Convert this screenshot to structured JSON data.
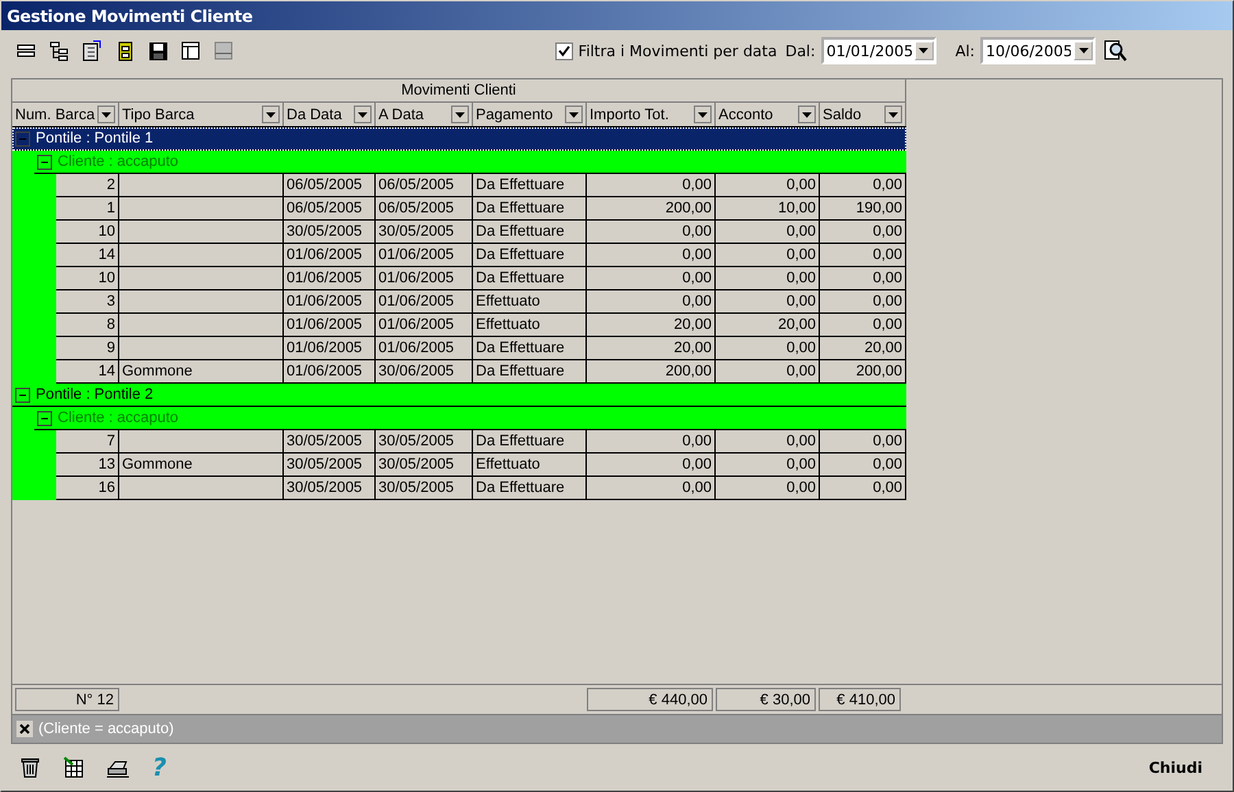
{
  "window": {
    "title": "Gestione Movimenti Cliente"
  },
  "filter": {
    "label": "Filtra i Movimenti per data",
    "checked": true,
    "from_label": "Dal:",
    "from_value": "01/01/2005",
    "to_label": "Al:",
    "to_value": "10/06/2005"
  },
  "grid": {
    "band": "Movimenti Clienti",
    "columns": [
      "Num. Barca",
      "Tipo Barca",
      "Da Data",
      "A Data",
      "Pagamento",
      "Importo Tot.",
      "Acconto",
      "Saldo"
    ],
    "groups": [
      {
        "label": "Pontile : Pontile 1",
        "selected": true,
        "expanded": true,
        "children": [
          {
            "label": "Cliente : accaputo",
            "expanded": true,
            "rows": [
              {
                "num_barca": "2",
                "da_data": "06/05/2005",
                "a_data": "06/05/2005",
                "pagamento": "Da Effettuare",
                "importo_tot": "0,00",
                "acconto": "0,00",
                "saldo": "0,00"
              },
              {
                "num_barca": "1",
                "da_data": "06/05/2005",
                "a_data": "06/05/2005",
                "pagamento": "Da Effettuare",
                "importo_tot": "200,00",
                "acconto": "10,00",
                "saldo": "190,00"
              },
              {
                "num_barca": "10",
                "da_data": "30/05/2005",
                "a_data": "30/05/2005",
                "pagamento": "Da Effettuare",
                "importo_tot": "0,00",
                "acconto": "0,00",
                "saldo": "0,00"
              },
              {
                "num_barca": "14",
                "da_data": "01/06/2005",
                "a_data": "01/06/2005",
                "pagamento": "Da Effettuare",
                "importo_tot": "0,00",
                "acconto": "0,00",
                "saldo": "0,00"
              },
              {
                "num_barca": "10",
                "da_data": "01/06/2005",
                "a_data": "01/06/2005",
                "pagamento": "Da Effettuare",
                "importo_tot": "0,00",
                "acconto": "0,00",
                "saldo": "0,00"
              },
              {
                "num_barca": "3",
                "da_data": "01/06/2005",
                "a_data": "01/06/2005",
                "pagamento": "Effettuato",
                "importo_tot": "0,00",
                "acconto": "0,00",
                "saldo": "0,00"
              },
              {
                "num_barca": "8",
                "da_data": "01/06/2005",
                "a_data": "01/06/2005",
                "pagamento": "Effettuato",
                "importo_tot": "20,00",
                "acconto": "20,00",
                "saldo": "0,00"
              },
              {
                "num_barca": "9",
                "da_data": "01/06/2005",
                "a_data": "01/06/2005",
                "pagamento": "Da Effettuare",
                "importo_tot": "20,00",
                "acconto": "0,00",
                "saldo": "20,00"
              },
              {
                "num_barca": "14",
                "tipo_barca": "Gommone",
                "da_data": "01/06/2005",
                "a_data": "30/06/2005",
                "pagamento": "Da Effettuare",
                "importo_tot": "200,00",
                "acconto": "0,00",
                "saldo": "200,00"
              }
            ]
          }
        ]
      },
      {
        "label": "Pontile : Pontile 2",
        "selected": false,
        "expanded": true,
        "children": [
          {
            "label": "Cliente : accaputo",
            "expanded": true,
            "rows": [
              {
                "num_barca": "7",
                "da_data": "30/05/2005",
                "a_data": "30/05/2005",
                "pagamento": "Da Effettuare",
                "importo_tot": "0,00",
                "acconto": "0,00",
                "saldo": "0,00"
              },
              {
                "num_barca": "13",
                "tipo_barca": "Gommone",
                "da_data": "30/05/2005",
                "a_data": "30/05/2005",
                "pagamento": "Effettuato",
                "importo_tot": "0,00",
                "acconto": "0,00",
                "saldo": "0,00"
              },
              {
                "num_barca": "16",
                "da_data": "30/05/2005",
                "a_data": "30/05/2005",
                "pagamento": "Da Effettuare",
                "importo_tot": "0,00",
                "acconto": "0,00",
                "saldo": "0,00"
              }
            ]
          }
        ]
      }
    ],
    "footer": {
      "count": "N° 12",
      "importo_tot": "€ 440,00",
      "acconto": "€ 30,00",
      "saldo": "€ 410,00"
    },
    "active_filter": "(Cliente = accaputo)"
  },
  "bottom": {
    "help": "?",
    "close_button": "Chiudi"
  }
}
